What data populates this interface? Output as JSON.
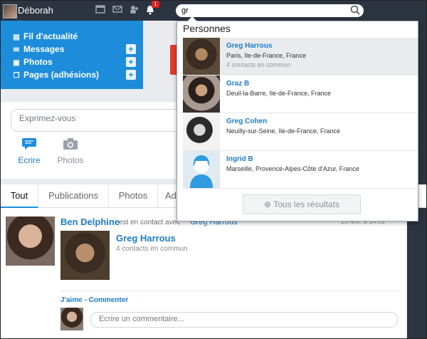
{
  "topbar": {
    "username": "Déborah",
    "notification_count": "1"
  },
  "search": {
    "value": "gr",
    "placeholder": ""
  },
  "left_menu": {
    "items": [
      {
        "label": "Fil d'actualité",
        "icon": "newsfeed-icon",
        "has_add": false
      },
      {
        "label": "Messages",
        "icon": "envelope-icon",
        "has_add": true
      },
      {
        "label": "Photos",
        "icon": "photo-icon",
        "has_add": true
      },
      {
        "label": "Pages (adhésions)",
        "icon": "pages-icon",
        "has_add": true
      }
    ]
  },
  "composer": {
    "placeholder": "Exprimez-vous",
    "write_label": "Ecrire",
    "photos_label": "Photos"
  },
  "tabs": [
    "Tout",
    "Publications",
    "Photos",
    "Ad"
  ],
  "feed": {
    "actor": "Ben Delphine",
    "action_text": "est en contact avec",
    "target": "Greg Harrous",
    "date": "25 févr. à 14:01",
    "card_name": "Greg Harrous",
    "card_sub": "4 contacts en commun",
    "like": "J'aime",
    "comment": "Commenter",
    "comment_placeholder": "Ecrire un commentaire..."
  },
  "dropdown": {
    "header": "Personnes",
    "results": [
      {
        "name": "Greg Harrous",
        "location": "Paris, Ile-de-France, France",
        "common": "4 contacts en commun"
      },
      {
        "name": "Graz B",
        "location": "Deuil-la-Barre, Ile-de-France, France",
        "common": ""
      },
      {
        "name": "Greg Cohen",
        "location": "Neuilly-sur-Seine, Ile-de-France, France",
        "common": ""
      },
      {
        "name": "Ingrid B",
        "location": "Marseille, Provence-Alpes-Côte d'Azur, France",
        "common": ""
      }
    ],
    "all_results": "Tous les résultats"
  },
  "colors": {
    "brand_blue": "#1d8ddb",
    "topbar": "#2b3440",
    "badge_red": "#e02020"
  }
}
